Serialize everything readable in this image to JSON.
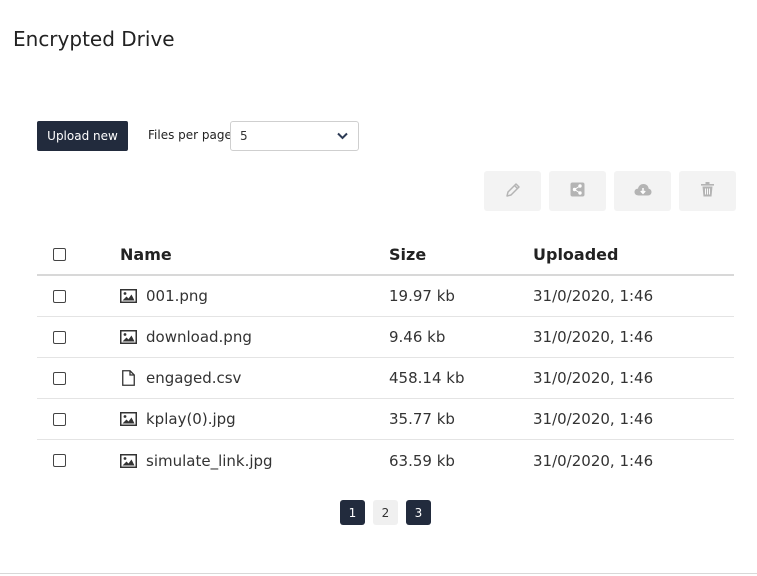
{
  "page": {
    "title": "Encrypted Drive"
  },
  "controls": {
    "upload_label": "Upload new",
    "per_page_label": "Files per page",
    "per_page_value": "5"
  },
  "toolbar": {
    "icons": [
      "pencil-icon",
      "share-icon",
      "cloud-download-icon",
      "trash-icon"
    ]
  },
  "table": {
    "headers": {
      "name": "Name",
      "size": "Size",
      "uploaded": "Uploaded"
    },
    "rows": [
      {
        "name": "001.png",
        "size": "19.97 kb",
        "uploaded": "31/0/2020, 1:46",
        "icon": "image-icon"
      },
      {
        "name": "download.png",
        "size": "9.46 kb",
        "uploaded": "31/0/2020, 1:46",
        "icon": "image-icon"
      },
      {
        "name": "engaged.csv",
        "size": "458.14 kb",
        "uploaded": "31/0/2020, 1:46",
        "icon": "document-icon"
      },
      {
        "name": "kplay(0).jpg",
        "size": "35.77 kb",
        "uploaded": "31/0/2020, 1:46",
        "icon": "image-icon"
      },
      {
        "name": "simulate_link.jpg",
        "size": "63.59 kb",
        "uploaded": "31/0/2020, 1:46",
        "icon": "image-icon"
      }
    ]
  },
  "pagination": {
    "pages": [
      "1",
      "2",
      "3"
    ]
  },
  "colors": {
    "primary": "#222b3d",
    "toolbar_bg": "#f3f3f3",
    "icon_muted": "#b4b4b4"
  }
}
